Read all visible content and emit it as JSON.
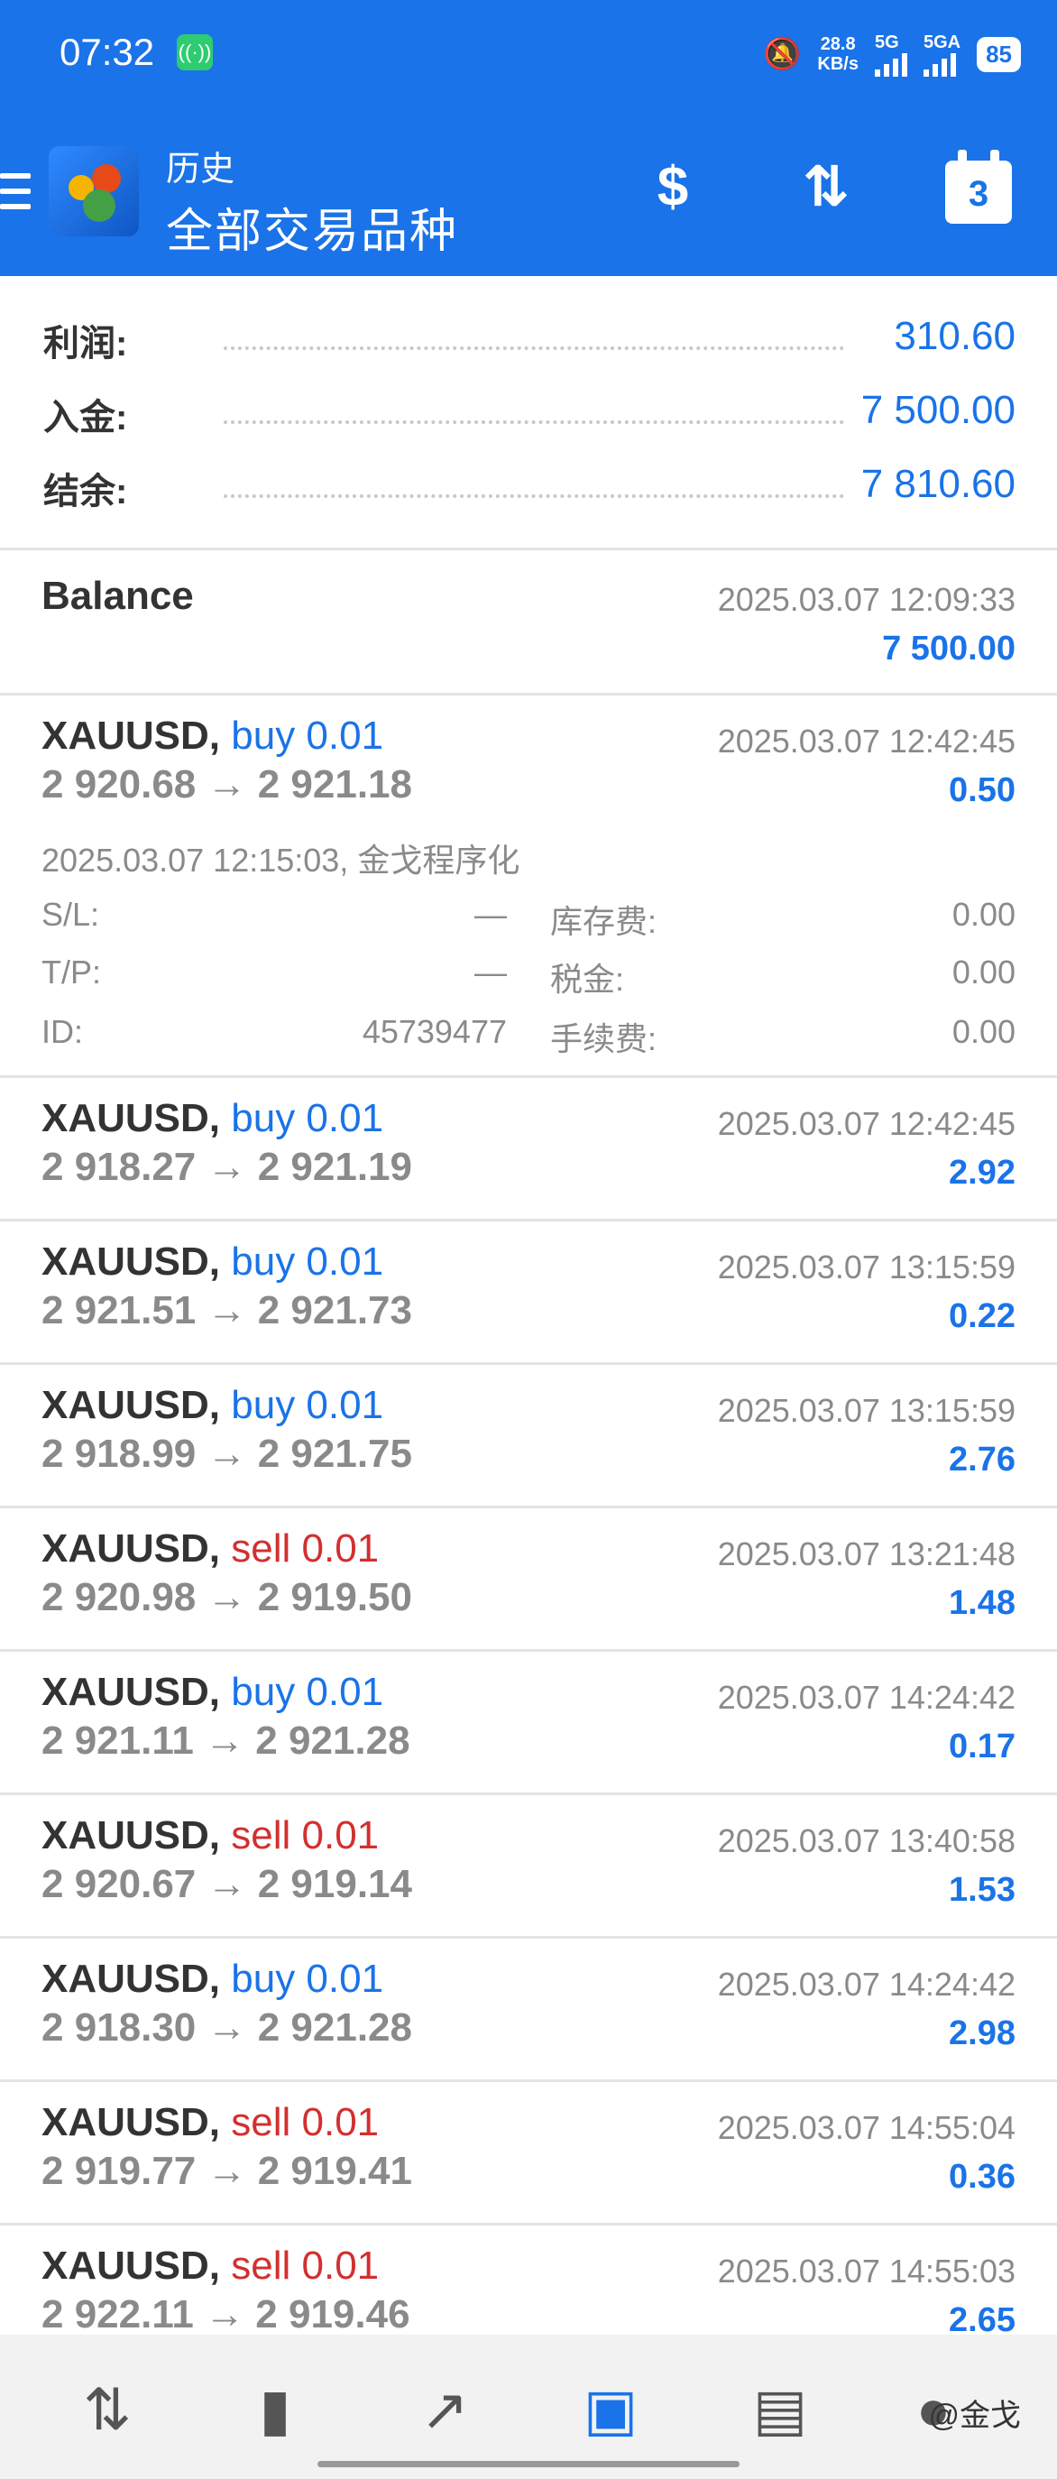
{
  "status_bar": {
    "time": "07:32",
    "net_speed": "28.8",
    "net_unit": "KB/s",
    "sim1": "5G",
    "sim2": "5GA",
    "battery": "85"
  },
  "header": {
    "title": "历史",
    "subtitle": "全部交易品种",
    "calendar_day": "3",
    "icons": [
      "menu-icon",
      "currency-exchange-icon",
      "sort-icon",
      "calendar-icon"
    ]
  },
  "summary": [
    {
      "label": "利润:",
      "value": "310.60"
    },
    {
      "label": "入金:",
      "value": "7 500.00"
    },
    {
      "label": "结余:",
      "value": "7 810.60"
    }
  ],
  "balance_entry": {
    "label": "Balance",
    "datetime": "2025.03.07 12:09:33",
    "amount": "7 500.00"
  },
  "expanded_trade": {
    "symbol": "XAUUSD,",
    "side": "buy 0.01",
    "side_type": "buy",
    "prices": "2 920.68 → 2 921.18",
    "datetime": "2025.03.07 12:42:45",
    "profit": "0.50",
    "open_info": "2025.03.07 12:15:03, 金戈程序化",
    "sl_label": "S/L:",
    "sl_value": "—",
    "tp_label": "T/P:",
    "tp_value": "—",
    "id_label": "ID:",
    "id_value": "45739477",
    "swap_label": "库存费:",
    "swap_value": "0.00",
    "tax_label": "税金:",
    "tax_value": "0.00",
    "fee_label": "手续费:",
    "fee_value": "0.00"
  },
  "trades": [
    {
      "symbol": "XAUUSD,",
      "side": "buy 0.01",
      "side_type": "buy",
      "prices": "2 918.27 → 2 921.19",
      "datetime": "2025.03.07 12:42:45",
      "profit": "2.92"
    },
    {
      "symbol": "XAUUSD,",
      "side": "buy 0.01",
      "side_type": "buy",
      "prices": "2 921.51 → 2 921.73",
      "datetime": "2025.03.07 13:15:59",
      "profit": "0.22"
    },
    {
      "symbol": "XAUUSD,",
      "side": "buy 0.01",
      "side_type": "buy",
      "prices": "2 918.99 → 2 921.75",
      "datetime": "2025.03.07 13:15:59",
      "profit": "2.76"
    },
    {
      "symbol": "XAUUSD,",
      "side": "sell 0.01",
      "side_type": "sell",
      "prices": "2 920.98 → 2 919.50",
      "datetime": "2025.03.07 13:21:48",
      "profit": "1.48"
    },
    {
      "symbol": "XAUUSD,",
      "side": "buy 0.01",
      "side_type": "buy",
      "prices": "2 921.11 → 2 921.28",
      "datetime": "2025.03.07 14:24:42",
      "profit": "0.17"
    },
    {
      "symbol": "XAUUSD,",
      "side": "sell 0.01",
      "side_type": "sell",
      "prices": "2 920.67 → 2 919.14",
      "datetime": "2025.03.07 13:40:58",
      "profit": "1.53"
    },
    {
      "symbol": "XAUUSD,",
      "side": "buy 0.01",
      "side_type": "buy",
      "prices": "2 918.30 → 2 921.28",
      "datetime": "2025.03.07 14:24:42",
      "profit": "2.98"
    },
    {
      "symbol": "XAUUSD,",
      "side": "sell 0.01",
      "side_type": "sell",
      "prices": "2 919.77 → 2 919.41",
      "datetime": "2025.03.07 14:55:04",
      "profit": "0.36"
    },
    {
      "symbol": "XAUUSD,",
      "side": "sell 0.01",
      "side_type": "sell",
      "prices": "2 922.11 → 2 919.46",
      "datetime": "2025.03.07 14:55:03",
      "profit": "2.65"
    }
  ],
  "bottom_nav": {
    "items": [
      "quotes-icon",
      "chart-icon",
      "trade-icon",
      "history-icon",
      "news-icon",
      "avatar-icon"
    ],
    "active": "history-icon",
    "watermark": "@金戈"
  },
  "colors": {
    "accent": "#1a73e8",
    "sell": "#d32f2f",
    "muted": "#8a8a8a"
  }
}
